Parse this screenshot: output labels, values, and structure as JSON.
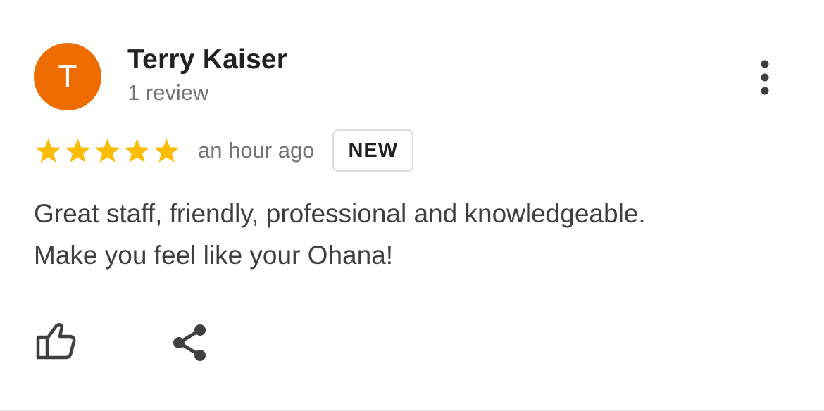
{
  "reviewer": {
    "initial": "T",
    "name": "Terry Kaiser",
    "review_count": "1 review",
    "avatar_color": "#ef6c00"
  },
  "rating": {
    "stars": 5,
    "max_stars": 5,
    "star_color": "#fbbc04"
  },
  "time_ago": "an hour ago",
  "badge": "NEW",
  "review_lines": [
    "Great staff, friendly, professional and knowledgeable.",
    "Make you feel like your Ohana!"
  ],
  "actions": {
    "like_icon": "thumb-up-outline",
    "share_icon": "share",
    "more_icon": "more-vertical"
  }
}
